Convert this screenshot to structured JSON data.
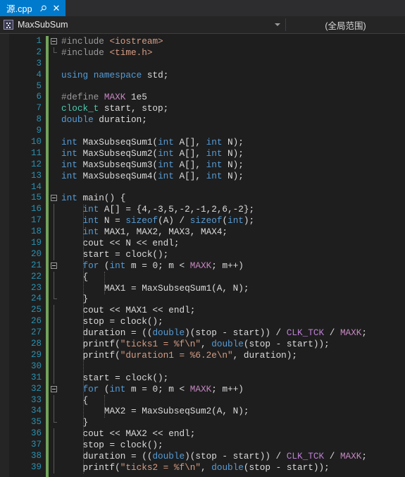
{
  "window": {
    "theme": "visual-studio-dark",
    "accent_color": "#007acc",
    "background": "#1e1e1e"
  },
  "tab_bar": {
    "tabs": [
      {
        "label": "源.cpp",
        "active": true,
        "pin_icon": "pin-icon",
        "close_icon": "close-icon",
        "close_label": "✕",
        "pin_label": "⚲"
      }
    ]
  },
  "nav_bar": {
    "project_icon": "class-icon",
    "member_scope": "MaxSubSum",
    "global_scope": "(全局范围)",
    "dropdown_icon": "chevron-down-icon"
  },
  "editor": {
    "language": "cpp",
    "change_bar_color": "#72a35b",
    "line_number_color": "#2b91af",
    "first_line": 1,
    "last_line": 39,
    "lines": [
      {
        "n": 1,
        "fold": "open",
        "tokens": [
          {
            "t": "#include ",
            "c": "pre"
          },
          {
            "t": "<iostream>",
            "c": "str"
          }
        ]
      },
      {
        "n": 2,
        "fold": "end",
        "tokens": [
          {
            "t": "#include ",
            "c": "pre"
          },
          {
            "t": "<time.h>",
            "c": "str"
          }
        ]
      },
      {
        "n": 3,
        "fold": "none",
        "tokens": []
      },
      {
        "n": 4,
        "fold": "none",
        "tokens": [
          {
            "t": "using",
            "c": "kw"
          },
          {
            "t": " ",
            "c": "pln"
          },
          {
            "t": "namespace",
            "c": "kw"
          },
          {
            "t": " std;",
            "c": "pln"
          }
        ]
      },
      {
        "n": 5,
        "fold": "none",
        "tokens": []
      },
      {
        "n": 6,
        "fold": "none",
        "tokens": [
          {
            "t": "#define ",
            "c": "pre"
          },
          {
            "t": "MAXK",
            "c": "macd"
          },
          {
            "t": " 1e5",
            "c": "pln"
          }
        ]
      },
      {
        "n": 7,
        "fold": "none",
        "tokens": [
          {
            "t": "clock_t",
            "c": "typ"
          },
          {
            "t": " start, stop;",
            "c": "pln"
          }
        ]
      },
      {
        "n": 8,
        "fold": "none",
        "tokens": [
          {
            "t": "double",
            "c": "kw"
          },
          {
            "t": " duration;",
            "c": "pln"
          }
        ]
      },
      {
        "n": 9,
        "fold": "none",
        "tokens": []
      },
      {
        "n": 10,
        "fold": "none",
        "tokens": [
          {
            "t": "int",
            "c": "kw"
          },
          {
            "t": " MaxSubseqSum1(",
            "c": "pln"
          },
          {
            "t": "int",
            "c": "kw"
          },
          {
            "t": " A[], ",
            "c": "pln"
          },
          {
            "t": "int",
            "c": "kw"
          },
          {
            "t": " N);",
            "c": "pln"
          }
        ]
      },
      {
        "n": 11,
        "fold": "none",
        "tokens": [
          {
            "t": "int",
            "c": "kw"
          },
          {
            "t": " MaxSubseqSum2(",
            "c": "pln"
          },
          {
            "t": "int",
            "c": "kw"
          },
          {
            "t": " A[], ",
            "c": "pln"
          },
          {
            "t": "int",
            "c": "kw"
          },
          {
            "t": " N);",
            "c": "pln"
          }
        ]
      },
      {
        "n": 12,
        "fold": "none",
        "tokens": [
          {
            "t": "int",
            "c": "kw"
          },
          {
            "t": " MaxSubseqSum3(",
            "c": "pln"
          },
          {
            "t": "int",
            "c": "kw"
          },
          {
            "t": " A[], ",
            "c": "pln"
          },
          {
            "t": "int",
            "c": "kw"
          },
          {
            "t": " N);",
            "c": "pln"
          }
        ]
      },
      {
        "n": 13,
        "fold": "none",
        "tokens": [
          {
            "t": "int",
            "c": "kw"
          },
          {
            "t": " MaxSubseqSum4(",
            "c": "pln"
          },
          {
            "t": "int",
            "c": "kw"
          },
          {
            "t": " A[], ",
            "c": "pln"
          },
          {
            "t": "int",
            "c": "kw"
          },
          {
            "t": " N);",
            "c": "pln"
          }
        ]
      },
      {
        "n": 14,
        "fold": "none",
        "tokens": []
      },
      {
        "n": 15,
        "fold": "open",
        "tokens": [
          {
            "t": "int",
            "c": "kw"
          },
          {
            "t": " main() {",
            "c": "pln"
          }
        ]
      },
      {
        "n": 16,
        "fold": "bar",
        "tokens": [
          {
            "t": "    ",
            "c": "pln"
          },
          {
            "t": "int",
            "c": "kw"
          },
          {
            "t": " A[] = {4,-3,5,-2,-1,2,6,-2};",
            "c": "pln"
          }
        ]
      },
      {
        "n": 17,
        "fold": "bar",
        "tokens": [
          {
            "t": "    ",
            "c": "pln"
          },
          {
            "t": "int",
            "c": "kw"
          },
          {
            "t": " N = ",
            "c": "pln"
          },
          {
            "t": "sizeof",
            "c": "kw"
          },
          {
            "t": "(A) / ",
            "c": "pln"
          },
          {
            "t": "sizeof",
            "c": "kw"
          },
          {
            "t": "(",
            "c": "pln"
          },
          {
            "t": "int",
            "c": "kw"
          },
          {
            "t": ");",
            "c": "pln"
          }
        ]
      },
      {
        "n": 18,
        "fold": "bar",
        "tokens": [
          {
            "t": "    ",
            "c": "pln"
          },
          {
            "t": "int",
            "c": "kw"
          },
          {
            "t": " MAX1, MAX2, MAX3, MAX4;",
            "c": "pln"
          }
        ]
      },
      {
        "n": 19,
        "fold": "bar",
        "tokens": [
          {
            "t": "    cout << N << endl;",
            "c": "pln"
          }
        ]
      },
      {
        "n": 20,
        "fold": "bar",
        "tokens": [
          {
            "t": "    start = clock();",
            "c": "pln"
          }
        ]
      },
      {
        "n": 21,
        "fold": "open2",
        "tokens": [
          {
            "t": "    ",
            "c": "pln"
          },
          {
            "t": "for",
            "c": "kw"
          },
          {
            "t": " (",
            "c": "pln"
          },
          {
            "t": "int",
            "c": "kw"
          },
          {
            "t": " m = 0; m < ",
            "c": "pln"
          },
          {
            "t": "MAXK",
            "c": "macd"
          },
          {
            "t": "; m++)",
            "c": "pln"
          }
        ]
      },
      {
        "n": 22,
        "fold": "bar2",
        "tokens": [
          {
            "t": "    {",
            "c": "pln"
          }
        ]
      },
      {
        "n": 23,
        "fold": "bar2",
        "tokens": [
          {
            "t": "        MAX1 = MaxSubseqSum1(A, N);",
            "c": "pln"
          }
        ]
      },
      {
        "n": 24,
        "fold": "end2",
        "tokens": [
          {
            "t": "    }",
            "c": "pln"
          }
        ]
      },
      {
        "n": 25,
        "fold": "bar",
        "tokens": [
          {
            "t": "    cout << MAX1 << endl;",
            "c": "pln"
          }
        ]
      },
      {
        "n": 26,
        "fold": "bar",
        "tokens": [
          {
            "t": "    stop = clock();",
            "c": "pln"
          }
        ]
      },
      {
        "n": 27,
        "fold": "bar",
        "tokens": [
          {
            "t": "    duration = ((",
            "c": "pln"
          },
          {
            "t": "double",
            "c": "kw"
          },
          {
            "t": ")(stop - start)) / ",
            "c": "pln"
          },
          {
            "t": "CLK_TCK",
            "c": "mac"
          },
          {
            "t": " / ",
            "c": "pln"
          },
          {
            "t": "MAXK",
            "c": "macd"
          },
          {
            "t": ";",
            "c": "pln"
          }
        ]
      },
      {
        "n": 28,
        "fold": "bar",
        "tokens": [
          {
            "t": "    printf(",
            "c": "pln"
          },
          {
            "t": "\"ticks1 = %f\\n\"",
            "c": "str"
          },
          {
            "t": ", ",
            "c": "pln"
          },
          {
            "t": "double",
            "c": "kw"
          },
          {
            "t": "(stop - start));",
            "c": "pln"
          }
        ]
      },
      {
        "n": 29,
        "fold": "bar",
        "tokens": [
          {
            "t": "    printf(",
            "c": "pln"
          },
          {
            "t": "\"duration1 = %6.2e\\n\"",
            "c": "str"
          },
          {
            "t": ", duration);",
            "c": "pln"
          }
        ]
      },
      {
        "n": 30,
        "fold": "bar",
        "tokens": []
      },
      {
        "n": 31,
        "fold": "bar",
        "tokens": [
          {
            "t": "    start = clock();",
            "c": "pln"
          }
        ]
      },
      {
        "n": 32,
        "fold": "open2",
        "tokens": [
          {
            "t": "    ",
            "c": "pln"
          },
          {
            "t": "for",
            "c": "kw"
          },
          {
            "t": " (",
            "c": "pln"
          },
          {
            "t": "int",
            "c": "kw"
          },
          {
            "t": " m = 0; m < ",
            "c": "pln"
          },
          {
            "t": "MAXK",
            "c": "macd"
          },
          {
            "t": "; m++)",
            "c": "pln"
          }
        ]
      },
      {
        "n": 33,
        "fold": "bar2",
        "tokens": [
          {
            "t": "    {",
            "c": "pln"
          }
        ]
      },
      {
        "n": 34,
        "fold": "bar2",
        "tokens": [
          {
            "t": "        MAX2 = MaxSubseqSum2(A, N);",
            "c": "pln"
          }
        ]
      },
      {
        "n": 35,
        "fold": "end2",
        "tokens": [
          {
            "t": "    }",
            "c": "pln"
          }
        ]
      },
      {
        "n": 36,
        "fold": "bar",
        "tokens": [
          {
            "t": "    cout << MAX2 << endl;",
            "c": "pln"
          }
        ]
      },
      {
        "n": 37,
        "fold": "bar",
        "tokens": [
          {
            "t": "    stop = clock();",
            "c": "pln"
          }
        ]
      },
      {
        "n": 38,
        "fold": "bar",
        "tokens": [
          {
            "t": "    duration = ((",
            "c": "pln"
          },
          {
            "t": "double",
            "c": "kw"
          },
          {
            "t": ")(stop - start)) / ",
            "c": "pln"
          },
          {
            "t": "CLK_TCK",
            "c": "mac"
          },
          {
            "t": " / ",
            "c": "pln"
          },
          {
            "t": "MAXK",
            "c": "macd"
          },
          {
            "t": ";",
            "c": "pln"
          }
        ]
      },
      {
        "n": 39,
        "fold": "bar",
        "tokens": [
          {
            "t": "    printf(",
            "c": "pln"
          },
          {
            "t": "\"ticks2 = %f\\n\"",
            "c": "str"
          },
          {
            "t": ", ",
            "c": "pln"
          },
          {
            "t": "double",
            "c": "kw"
          },
          {
            "t": "(stop - start));",
            "c": "pln"
          }
        ]
      }
    ]
  }
}
